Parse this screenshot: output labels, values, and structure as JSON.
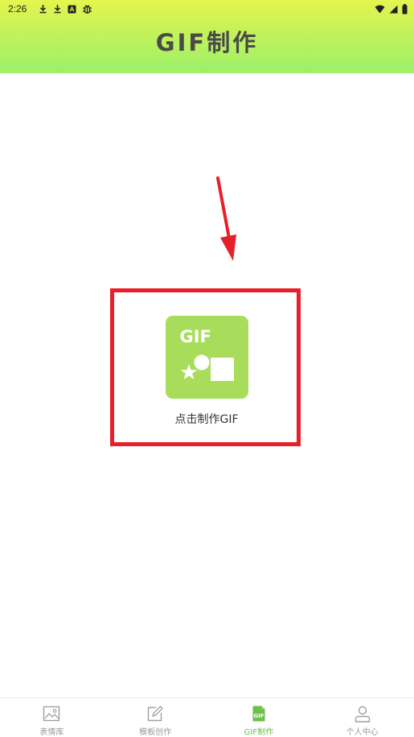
{
  "status_bar": {
    "time": "2:26",
    "left_icons": [
      "download-icon",
      "download-icon",
      "app-notification-icon",
      "bug-icon"
    ],
    "right_icons": [
      "wifi-icon",
      "signal-icon",
      "battery-icon"
    ]
  },
  "header": {
    "title": "GIF制作",
    "gradient_colors": [
      "#e4f54e",
      "#9cf06a"
    ]
  },
  "main": {
    "make_gif_tile": {
      "tile_text": "GIF",
      "label": "点击制作GIF",
      "tile_color": "#a7dd5b"
    },
    "annotation": {
      "arrow_color": "#e5202a",
      "box_color": "#e5202a"
    }
  },
  "tab_bar": {
    "active_color": "#6cc04a",
    "tabs": [
      {
        "label": "表情库",
        "icon": "image-icon",
        "active": false
      },
      {
        "label": "模板创作",
        "icon": "edit-icon",
        "active": false
      },
      {
        "label": "GIF制作",
        "icon": "gif-file-icon",
        "active": true
      },
      {
        "label": "个人中心",
        "icon": "person-icon",
        "active": false
      }
    ]
  }
}
